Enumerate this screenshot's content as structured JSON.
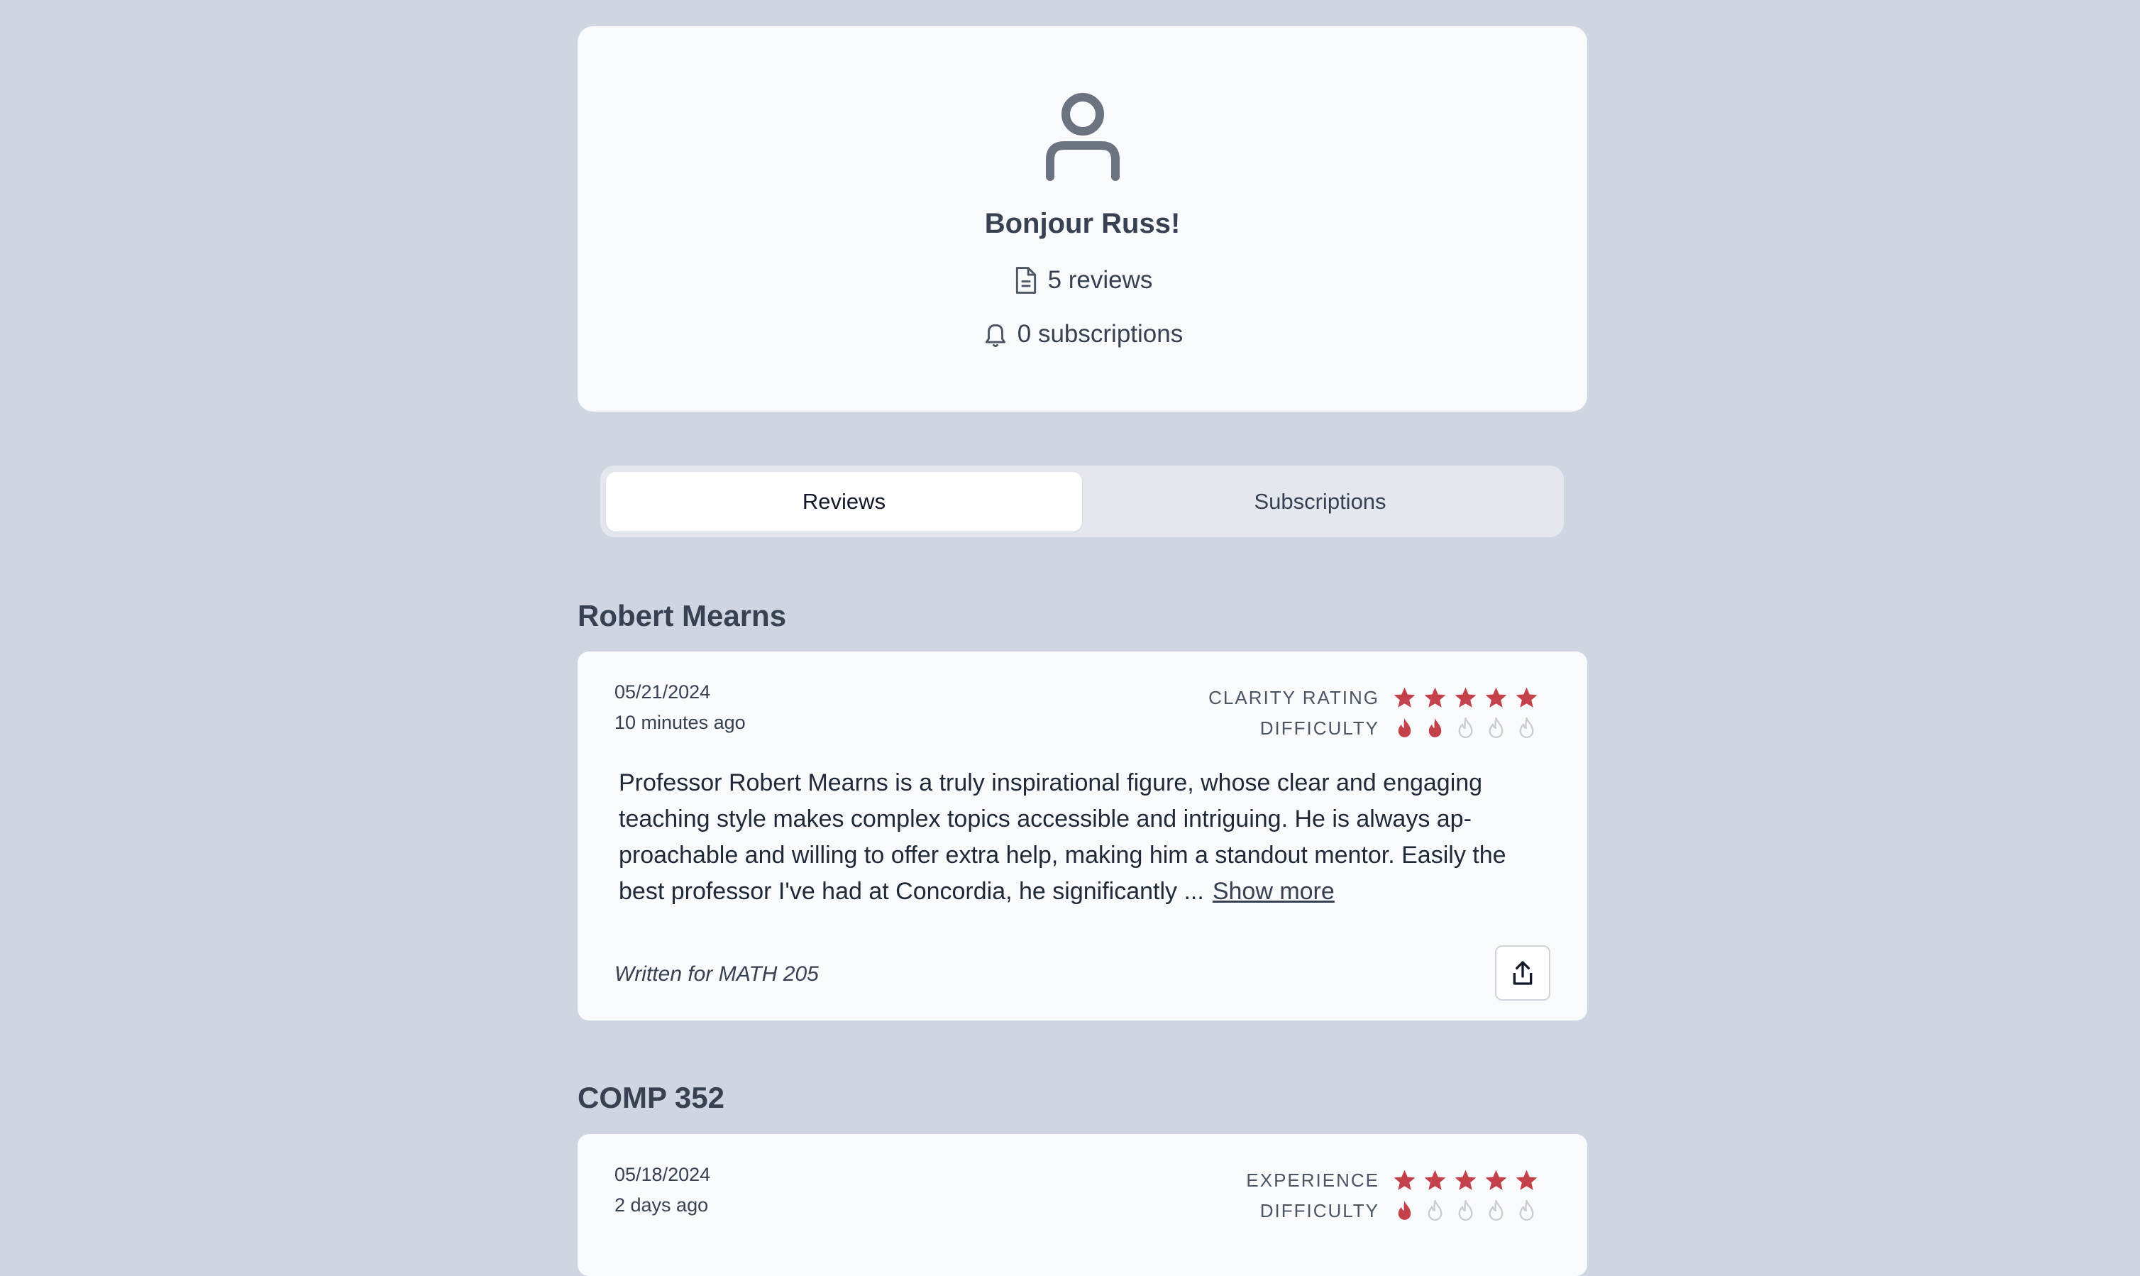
{
  "profile": {
    "greeting": "Bonjour Russ!",
    "reviews_count_label": "5 reviews",
    "subscriptions_count_label": "0 subscriptions"
  },
  "tabs": [
    {
      "label": "Reviews",
      "active": true
    },
    {
      "label": "Subscriptions",
      "active": false
    }
  ],
  "reviews": [
    {
      "heading": "Robert Mearns",
      "date": "05/21/2024",
      "relative_time": "10 minutes ago",
      "rating_label": "CLARITY RATING",
      "rating_value": 5,
      "difficulty_label": "DIFFICULTY",
      "difficulty_value": 2,
      "text": "Professor Robert Mearns is a truly inspirational figure, whose clear and engaging teaching style makes complex topics accessible and intriguing. He is always ap-proachable and willing to offer extra help, making him a standout mentor. Easily the best professor I've had at Concordia, he significantly ...",
      "show_more_label": "Show more",
      "written_for_prefix": "Written for",
      "written_for_course": "MATH 205"
    },
    {
      "heading": "COMP 352",
      "date": "05/18/2024",
      "relative_time": "2 days ago",
      "rating_label": "EXPERIENCE",
      "rating_value": 5,
      "difficulty_label": "DIFFICULTY",
      "difficulty_value": 1
    }
  ],
  "colors": {
    "accent": "#c2414b",
    "inactive_icon": "#c8cdd4",
    "background": "#cfd6e1",
    "card": "#f8fafc"
  },
  "icons": {
    "avatar": "user-icon",
    "reviews": "document-icon",
    "subscriptions": "bell-icon",
    "rating": "star-icon",
    "difficulty": "flame-icon",
    "share": "share-icon"
  }
}
